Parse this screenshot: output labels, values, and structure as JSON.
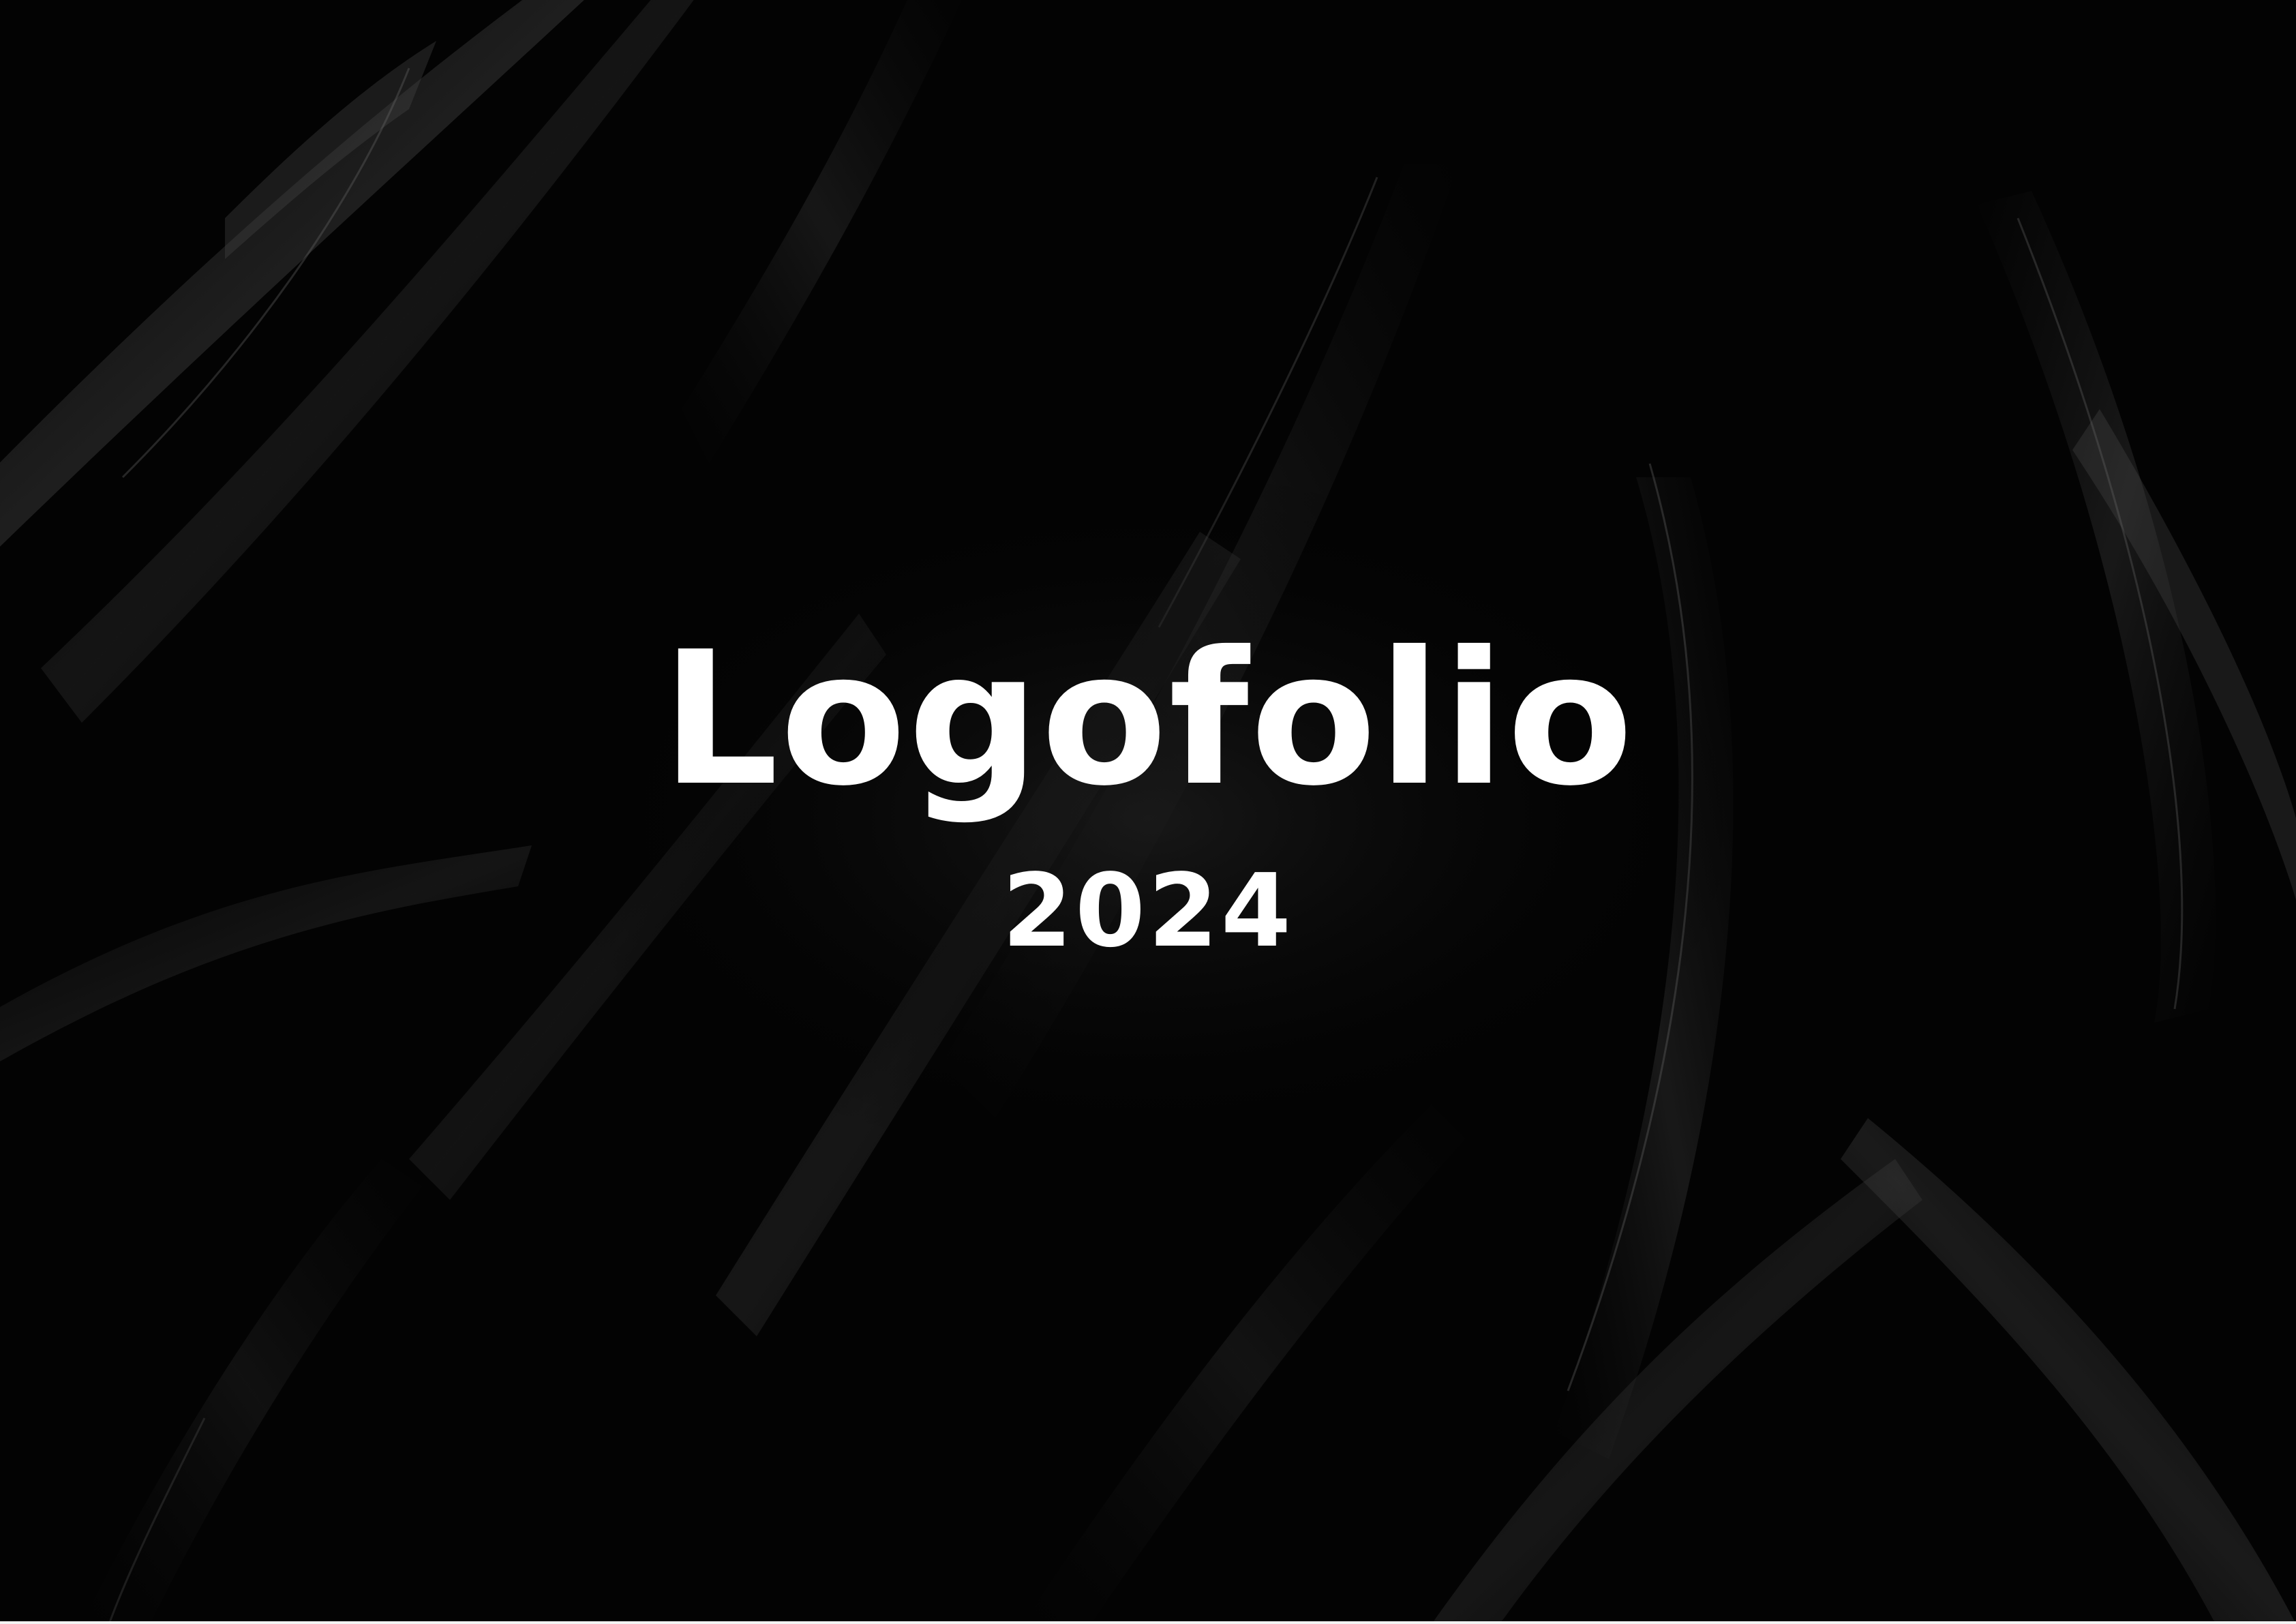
{
  "cover": {
    "title": "Logofolio",
    "year": "2024"
  },
  "colors": {
    "background": "#020202",
    "text": "#ffffff",
    "highlight": "#5a5a5a"
  }
}
